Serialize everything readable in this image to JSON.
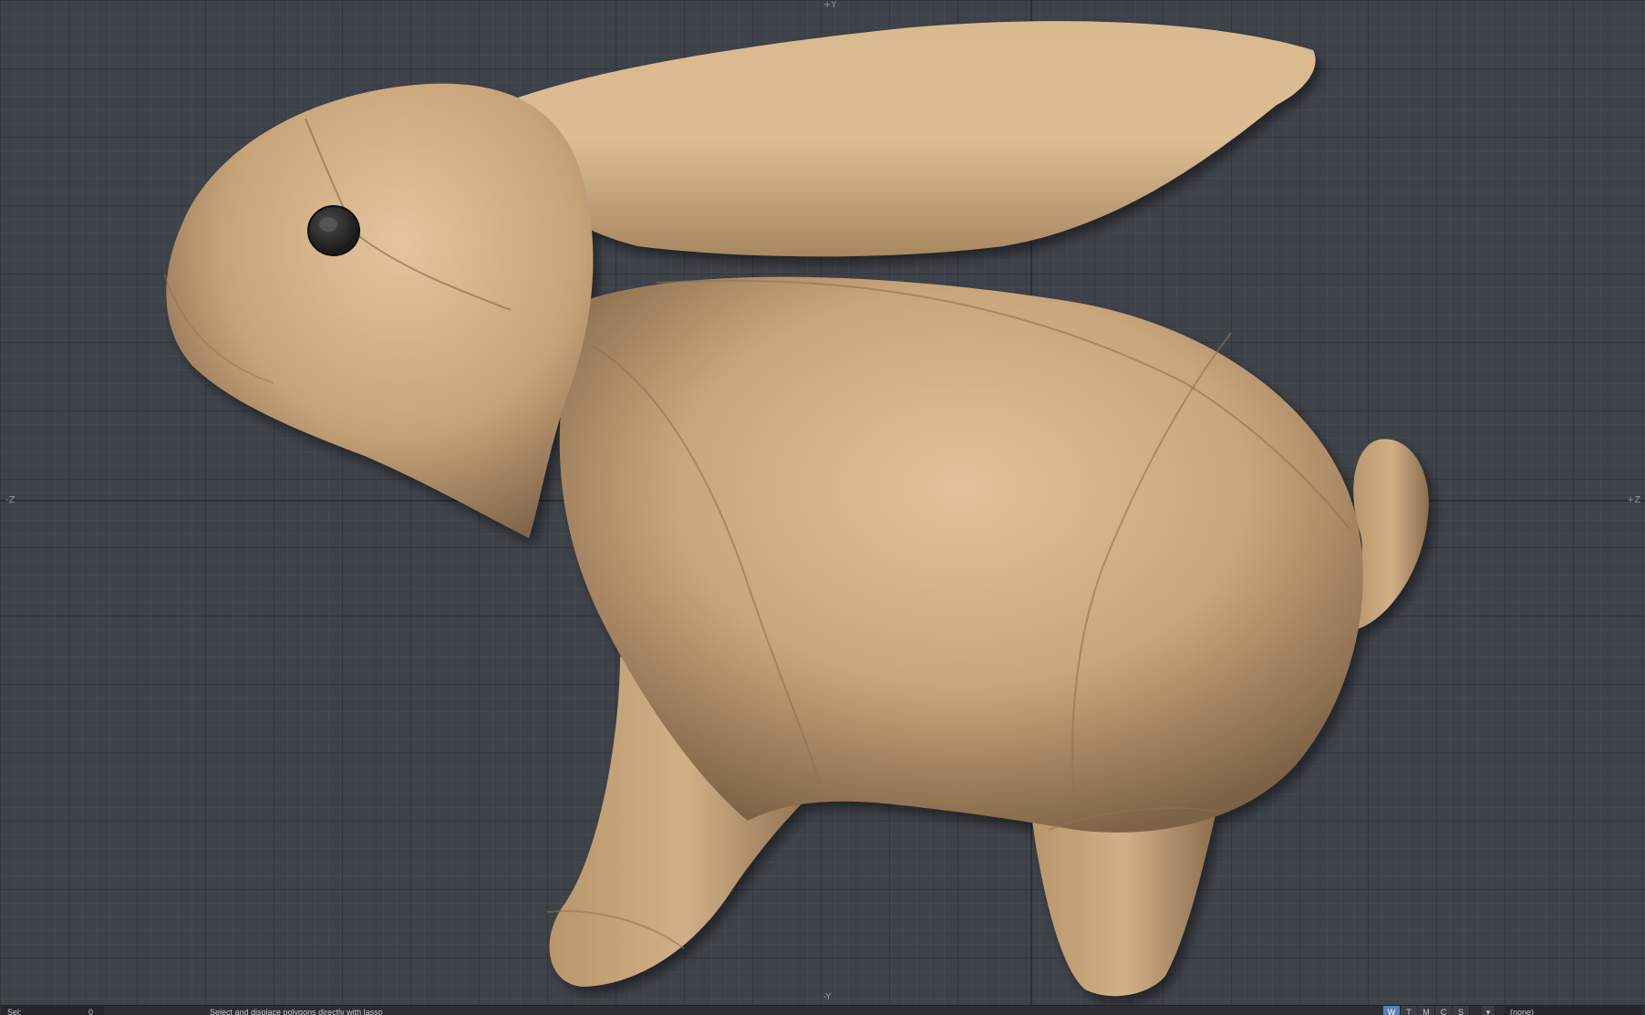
{
  "viewport": {
    "axis_top": "+Y",
    "axis_left": "-Z",
    "axis_right": "+Z",
    "axis_bottom": "-Y"
  },
  "statusbar": {
    "sel_label": "Sel:",
    "sel_count": "0",
    "message": "Select and displace polygons directly with lasso",
    "mode_buttons": [
      "W",
      "T",
      "M",
      "C",
      "S"
    ],
    "layer_dropdown": "(none)"
  },
  "colors": {
    "viewport_bg": "#3e4249",
    "grid_minor": "#4a4f56",
    "grid_major": "#2b2e33",
    "model_base": "#c6a37a",
    "active_mode": "#5a7fb8"
  }
}
